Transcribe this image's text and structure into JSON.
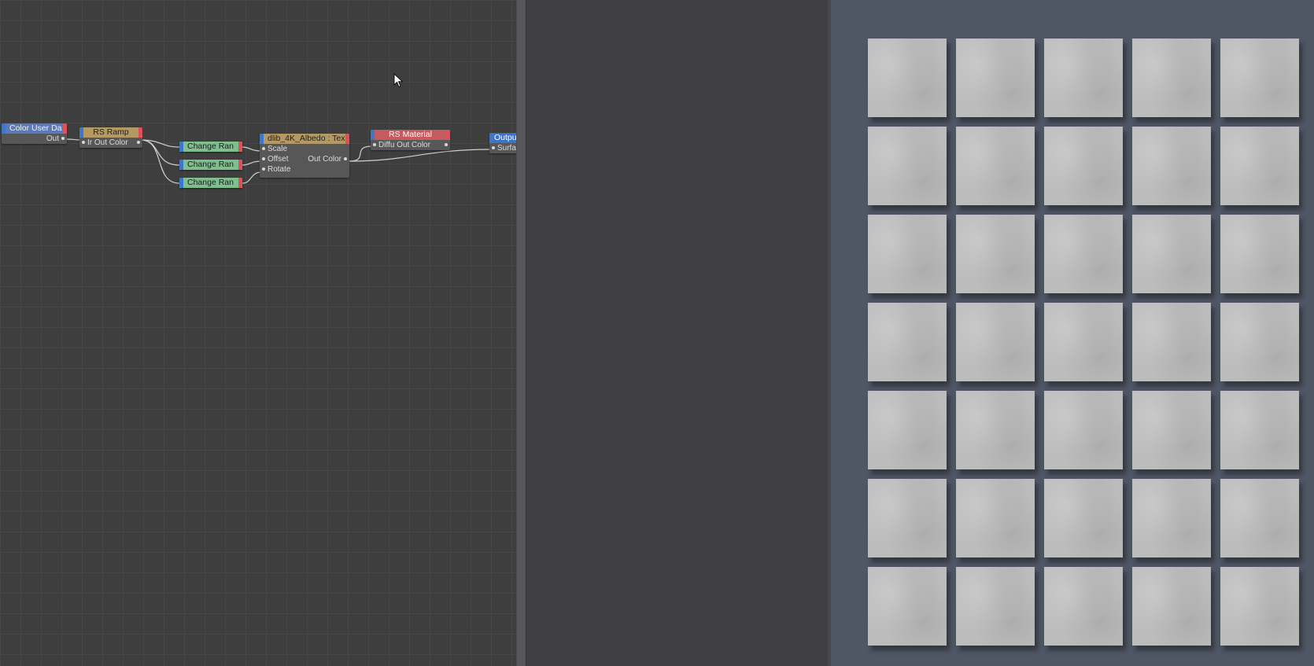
{
  "node_editor": {
    "nodes": [
      {
        "id": "color-user-data",
        "title": "Color User Da",
        "outputs": [
          "Out"
        ]
      },
      {
        "id": "rs-ramp",
        "title": "RS Ramp",
        "rows": [
          "Ir Out Color"
        ]
      },
      {
        "id": "change-range-1",
        "title": "Change Ran"
      },
      {
        "id": "change-range-2",
        "title": "Change Ran"
      },
      {
        "id": "change-range-3",
        "title": "Change Ran"
      },
      {
        "id": "texture",
        "title": "dlib_4K_Albedo : Tex",
        "inputs": [
          "Scale",
          "Offset",
          "Rotate"
        ],
        "output": "Out Color"
      },
      {
        "id": "rs-material",
        "title": "RS Material",
        "rows": [
          "Diffu Out Color"
        ]
      },
      {
        "id": "output",
        "title": "Outpu",
        "rows": [
          "Surfa"
        ]
      }
    ]
  },
  "viewport": {
    "grid_columns": 5,
    "grid_rows": 7,
    "tile_count": 35,
    "tile_color": "#bcbcbc",
    "background": "#4f5764"
  },
  "icons": {
    "cursor": "mouse-pointer-icon"
  }
}
